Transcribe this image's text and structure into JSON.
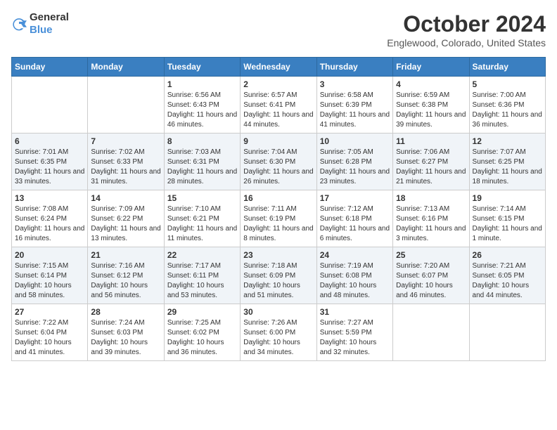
{
  "header": {
    "logo_general": "General",
    "logo_blue": "Blue",
    "month_title": "October 2024",
    "subtitle": "Englewood, Colorado, United States"
  },
  "weekdays": [
    "Sunday",
    "Monday",
    "Tuesday",
    "Wednesday",
    "Thursday",
    "Friday",
    "Saturday"
  ],
  "weeks": [
    [
      {
        "day": "",
        "info": ""
      },
      {
        "day": "",
        "info": ""
      },
      {
        "day": "1",
        "info": "Sunrise: 6:56 AM\nSunset: 6:43 PM\nDaylight: 11 hours and 46 minutes."
      },
      {
        "day": "2",
        "info": "Sunrise: 6:57 AM\nSunset: 6:41 PM\nDaylight: 11 hours and 44 minutes."
      },
      {
        "day": "3",
        "info": "Sunrise: 6:58 AM\nSunset: 6:39 PM\nDaylight: 11 hours and 41 minutes."
      },
      {
        "day": "4",
        "info": "Sunrise: 6:59 AM\nSunset: 6:38 PM\nDaylight: 11 hours and 39 minutes."
      },
      {
        "day": "5",
        "info": "Sunrise: 7:00 AM\nSunset: 6:36 PM\nDaylight: 11 hours and 36 minutes."
      }
    ],
    [
      {
        "day": "6",
        "info": "Sunrise: 7:01 AM\nSunset: 6:35 PM\nDaylight: 11 hours and 33 minutes."
      },
      {
        "day": "7",
        "info": "Sunrise: 7:02 AM\nSunset: 6:33 PM\nDaylight: 11 hours and 31 minutes."
      },
      {
        "day": "8",
        "info": "Sunrise: 7:03 AM\nSunset: 6:31 PM\nDaylight: 11 hours and 28 minutes."
      },
      {
        "day": "9",
        "info": "Sunrise: 7:04 AM\nSunset: 6:30 PM\nDaylight: 11 hours and 26 minutes."
      },
      {
        "day": "10",
        "info": "Sunrise: 7:05 AM\nSunset: 6:28 PM\nDaylight: 11 hours and 23 minutes."
      },
      {
        "day": "11",
        "info": "Sunrise: 7:06 AM\nSunset: 6:27 PM\nDaylight: 11 hours and 21 minutes."
      },
      {
        "day": "12",
        "info": "Sunrise: 7:07 AM\nSunset: 6:25 PM\nDaylight: 11 hours and 18 minutes."
      }
    ],
    [
      {
        "day": "13",
        "info": "Sunrise: 7:08 AM\nSunset: 6:24 PM\nDaylight: 11 hours and 16 minutes."
      },
      {
        "day": "14",
        "info": "Sunrise: 7:09 AM\nSunset: 6:22 PM\nDaylight: 11 hours and 13 minutes."
      },
      {
        "day": "15",
        "info": "Sunrise: 7:10 AM\nSunset: 6:21 PM\nDaylight: 11 hours and 11 minutes."
      },
      {
        "day": "16",
        "info": "Sunrise: 7:11 AM\nSunset: 6:19 PM\nDaylight: 11 hours and 8 minutes."
      },
      {
        "day": "17",
        "info": "Sunrise: 7:12 AM\nSunset: 6:18 PM\nDaylight: 11 hours and 6 minutes."
      },
      {
        "day": "18",
        "info": "Sunrise: 7:13 AM\nSunset: 6:16 PM\nDaylight: 11 hours and 3 minutes."
      },
      {
        "day": "19",
        "info": "Sunrise: 7:14 AM\nSunset: 6:15 PM\nDaylight: 11 hours and 1 minute."
      }
    ],
    [
      {
        "day": "20",
        "info": "Sunrise: 7:15 AM\nSunset: 6:14 PM\nDaylight: 10 hours and 58 minutes."
      },
      {
        "day": "21",
        "info": "Sunrise: 7:16 AM\nSunset: 6:12 PM\nDaylight: 10 hours and 56 minutes."
      },
      {
        "day": "22",
        "info": "Sunrise: 7:17 AM\nSunset: 6:11 PM\nDaylight: 10 hours and 53 minutes."
      },
      {
        "day": "23",
        "info": "Sunrise: 7:18 AM\nSunset: 6:09 PM\nDaylight: 10 hours and 51 minutes."
      },
      {
        "day": "24",
        "info": "Sunrise: 7:19 AM\nSunset: 6:08 PM\nDaylight: 10 hours and 48 minutes."
      },
      {
        "day": "25",
        "info": "Sunrise: 7:20 AM\nSunset: 6:07 PM\nDaylight: 10 hours and 46 minutes."
      },
      {
        "day": "26",
        "info": "Sunrise: 7:21 AM\nSunset: 6:05 PM\nDaylight: 10 hours and 44 minutes."
      }
    ],
    [
      {
        "day": "27",
        "info": "Sunrise: 7:22 AM\nSunset: 6:04 PM\nDaylight: 10 hours and 41 minutes."
      },
      {
        "day": "28",
        "info": "Sunrise: 7:24 AM\nSunset: 6:03 PM\nDaylight: 10 hours and 39 minutes."
      },
      {
        "day": "29",
        "info": "Sunrise: 7:25 AM\nSunset: 6:02 PM\nDaylight: 10 hours and 36 minutes."
      },
      {
        "day": "30",
        "info": "Sunrise: 7:26 AM\nSunset: 6:00 PM\nDaylight: 10 hours and 34 minutes."
      },
      {
        "day": "31",
        "info": "Sunrise: 7:27 AM\nSunset: 5:59 PM\nDaylight: 10 hours and 32 minutes."
      },
      {
        "day": "",
        "info": ""
      },
      {
        "day": "",
        "info": ""
      }
    ]
  ]
}
